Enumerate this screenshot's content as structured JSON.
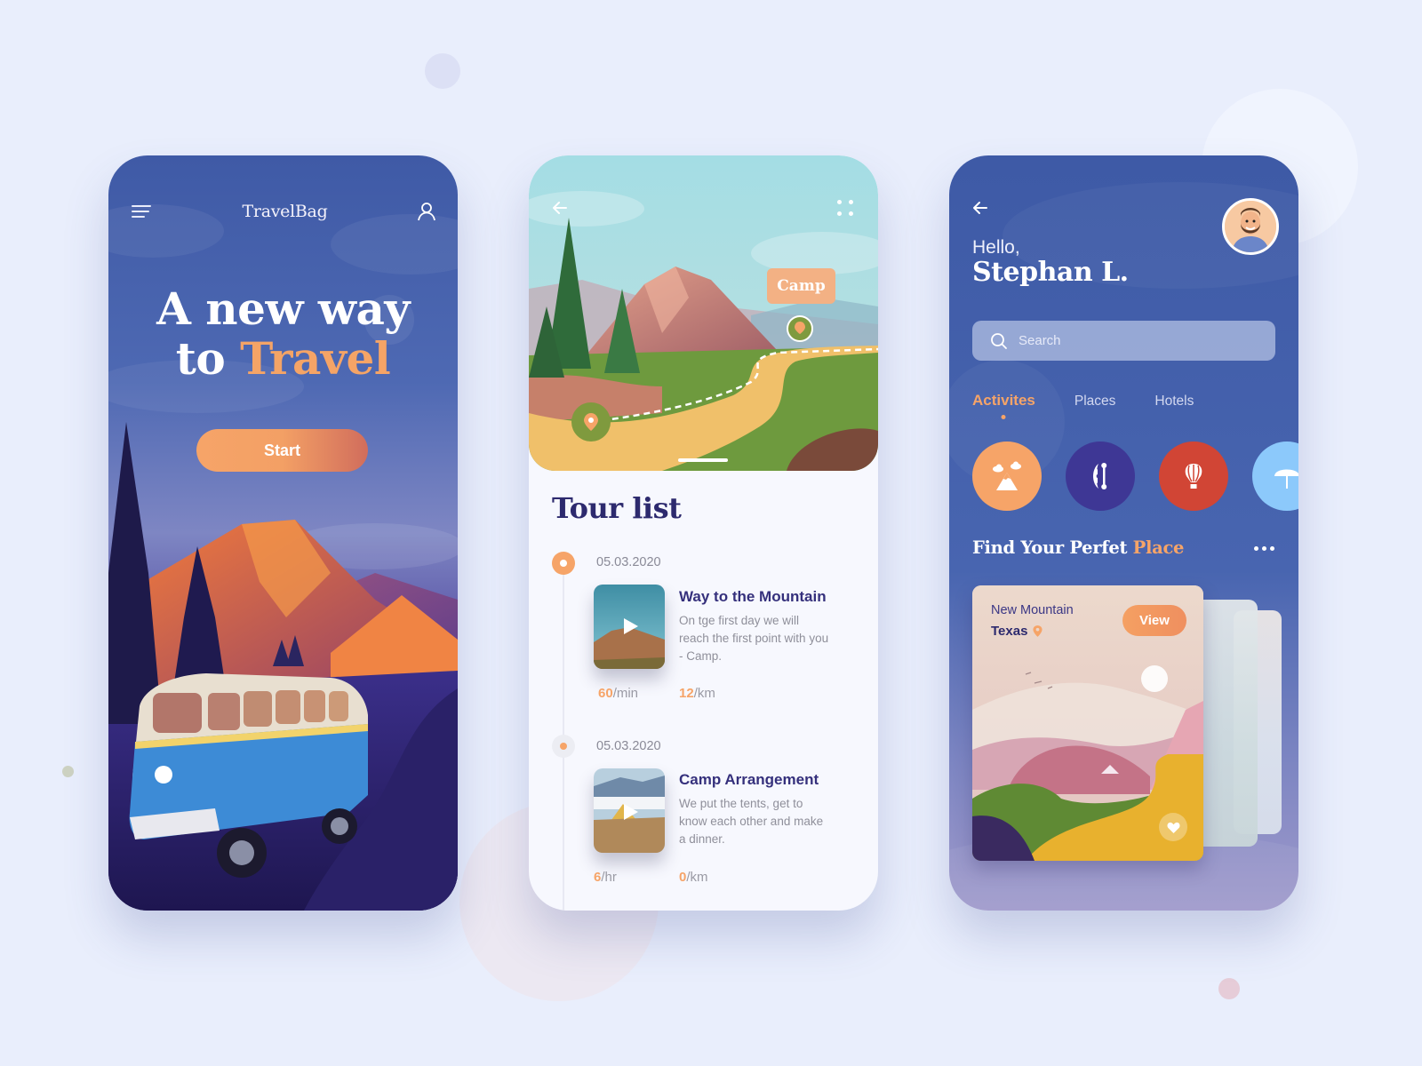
{
  "screen1": {
    "brand": "TravelBag",
    "hero_line1": "A new way",
    "hero_line2_prefix": "to ",
    "hero_line2_accent": "Travel",
    "start_label": "Start",
    "icons": {
      "menu": "hamburger-menu-icon",
      "user": "user-icon"
    }
  },
  "screen2": {
    "camp_tag": "Camp",
    "title": "Tour list",
    "tours": [
      {
        "date": "05.03.2020",
        "name": "Way to the Mountain",
        "description": "On tge first day we will reach the first point with you - Camp.",
        "stat1_value": "60",
        "stat1_unit": "/min",
        "stat2_value": "12",
        "stat2_unit": "/km",
        "active": true
      },
      {
        "date": "05.03.2020",
        "name": "Camp Arrangement",
        "description": "We put the tents, get to know each other and make a dinner.",
        "stat1_value": "6",
        "stat1_unit": "/hr",
        "stat2_value": "0",
        "stat2_unit": "/km",
        "active": false
      }
    ]
  },
  "screen3": {
    "greeting": "Hello,",
    "user_name": "Stephan L.",
    "search_placeholder": "Search",
    "tabs": [
      {
        "label": "Activites",
        "active": true
      },
      {
        "label": "Places",
        "active": false
      },
      {
        "label": "Hotels",
        "active": false
      }
    ],
    "activities": [
      {
        "name": "mountain-icon",
        "color": "#f6a468"
      },
      {
        "name": "kayak-icon",
        "color": "#3e3795"
      },
      {
        "name": "hot-air-balloon-icon",
        "color": "#d14535"
      },
      {
        "name": "beach-umbrella-icon",
        "color": "#8cc9fb"
      }
    ],
    "section_title_prefix": "Find Your Perfet ",
    "section_title_accent": "Place",
    "place": {
      "name": "New Mountain",
      "location": "Texas",
      "view_label": "View"
    }
  },
  "colors": {
    "accent": "#f6a468",
    "primary_blue": "#3f5aa6",
    "dark_navy": "#2d2a6e",
    "background": "#e9eefc"
  }
}
